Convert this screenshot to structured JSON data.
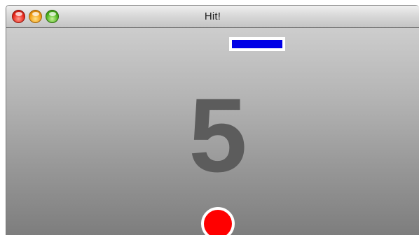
{
  "window": {
    "title": "Hit!",
    "controls": [
      {
        "name": "close",
        "color": "#e8271b"
      },
      {
        "name": "minimize",
        "color": "#f39c12"
      },
      {
        "name": "zoom",
        "color": "#4fb51f"
      }
    ]
  },
  "game": {
    "score": "5",
    "paddle_color": "#0000e6",
    "ball_color": "#ff0000",
    "background_top": "#cdcdcd",
    "background_bottom": "#7d7d7d"
  }
}
